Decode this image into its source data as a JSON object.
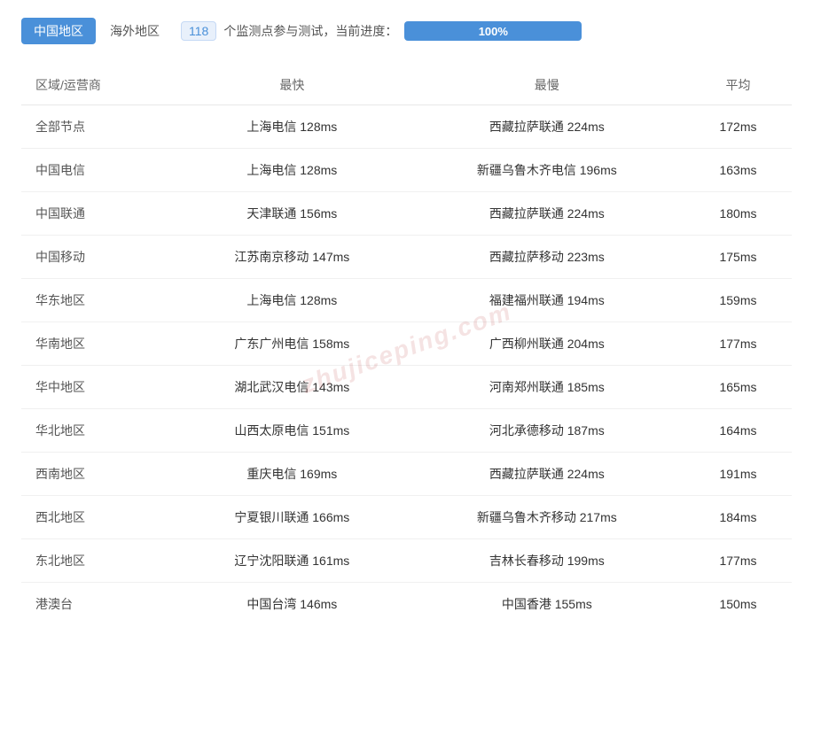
{
  "header": {
    "tab_china": "中国地区",
    "tab_overseas": "海外地区",
    "badge_count": "118",
    "monitor_text": "个监测点参与测试，当前进度：",
    "progress_label": "100%"
  },
  "table": {
    "columns": [
      "区域/运营商",
      "最快",
      "最慢",
      "平均"
    ],
    "rows": [
      {
        "region": "全部节点",
        "fastest": "上海电信 128ms",
        "slowest": "西藏拉萨联通 224ms",
        "avg": "172ms"
      },
      {
        "region": "中国电信",
        "fastest": "上海电信 128ms",
        "slowest": "新疆乌鲁木齐电信 196ms",
        "avg": "163ms"
      },
      {
        "region": "中国联通",
        "fastest": "天津联通 156ms",
        "slowest": "西藏拉萨联通 224ms",
        "avg": "180ms"
      },
      {
        "region": "中国移动",
        "fastest": "江苏南京移动 147ms",
        "slowest": "西藏拉萨移动 223ms",
        "avg": "175ms"
      },
      {
        "region": "华东地区",
        "fastest": "上海电信 128ms",
        "slowest": "福建福州联通 194ms",
        "avg": "159ms"
      },
      {
        "region": "华南地区",
        "fastest": "广东广州电信 158ms",
        "slowest": "广西柳州联通 204ms",
        "avg": "177ms"
      },
      {
        "region": "华中地区",
        "fastest": "湖北武汉电信 143ms",
        "slowest": "河南郑州联通 185ms",
        "avg": "165ms"
      },
      {
        "region": "华北地区",
        "fastest": "山西太原电信 151ms",
        "slowest": "河北承德移动 187ms",
        "avg": "164ms"
      },
      {
        "region": "西南地区",
        "fastest": "重庆电信 169ms",
        "slowest": "西藏拉萨联通 224ms",
        "avg": "191ms"
      },
      {
        "region": "西北地区",
        "fastest": "宁夏银川联通 166ms",
        "slowest": "新疆乌鲁木齐移动 217ms",
        "avg": "184ms"
      },
      {
        "region": "东北地区",
        "fastest": "辽宁沈阳联通 161ms",
        "slowest": "吉林长春移动 199ms",
        "avg": "177ms"
      },
      {
        "region": "港澳台",
        "fastest": "中国台湾 146ms",
        "slowest": "中国香港 155ms",
        "avg": "150ms"
      }
    ]
  },
  "watermark": "zhujiceping.com"
}
